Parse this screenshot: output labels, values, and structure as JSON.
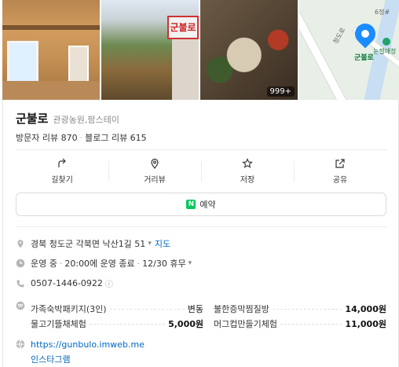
{
  "photos": {
    "count_badge": "999+",
    "sign_text": "군불로",
    "map": {
      "pin_label": "군불로",
      "labels": [
        "6정#",
        "눈썰매장",
        "청도로"
      ]
    }
  },
  "place": {
    "name": "군불로",
    "category": "관광농원,팜스테이",
    "visitor_reviews": "방문자 리뷰 870",
    "blog_reviews": "블로그 리뷰 615"
  },
  "actions": [
    {
      "label": "길찾기",
      "icon": "directions-icon"
    },
    {
      "label": "거리뷰",
      "icon": "street-view-icon"
    },
    {
      "label": "저장",
      "icon": "star-icon"
    },
    {
      "label": "공유",
      "icon": "share-icon"
    }
  ],
  "reserve": {
    "label": "예약",
    "badge": "N"
  },
  "address": {
    "text": "경북 청도군 각북면 낙산1길 51",
    "map_link": "지도"
  },
  "hours": {
    "status": "운영 중",
    "detail": "20:00에 운영 종료",
    "holiday": "12/30 휴무"
  },
  "phone": {
    "number": "0507-1446-0922"
  },
  "menu": [
    [
      {
        "name": "가족숙박패키지(3인)",
        "price": "변동"
      },
      {
        "name": "불한증막찜질방",
        "price": "14,000원"
      }
    ],
    [
      {
        "name": "물고기뜰채체험",
        "price": "5,000원"
      },
      {
        "name": "머그컵만들기체험",
        "price": "11,000원"
      }
    ]
  ],
  "website": {
    "url": "https://gunbulo.imweb.me",
    "instagram": "인스타그램"
  },
  "colors": {
    "link": "#0068c3",
    "naver_green": "#03c75a",
    "pin_blue": "#1a8cff"
  }
}
